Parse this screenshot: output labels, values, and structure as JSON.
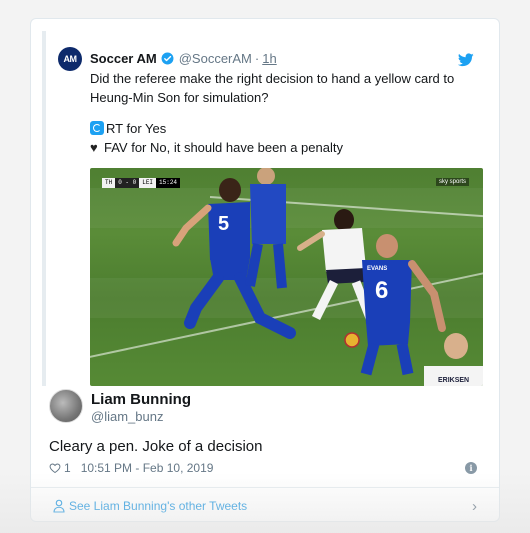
{
  "quoted_tweet": {
    "author_name": "Soccer AM",
    "author_handle": "@SoccerAM",
    "separator": "·",
    "time": "1h",
    "avatar_text": "AM",
    "text_line1": "Did the referee make the right decision to hand a yellow card to",
    "text_line2": "Heung-Min Son for simulation?",
    "rt_option": "RT for Yes",
    "fav_option": "FAV for No, it should have been a penalty",
    "image_overlay": {
      "team_a": "TH",
      "score": "0 - 0",
      "team_b": "LEI",
      "clock": "15:24",
      "channel_badge": "sky sports",
      "jersey_1": "5",
      "jersey_2": "6",
      "jersey_name": "EVANS",
      "jersey_name_2": "ERIKSEN"
    }
  },
  "tweet": {
    "author_name": "Liam Bunning",
    "author_handle": "@liam_bunz",
    "text": "Cleary a pen. Joke of a decision",
    "like_count": "1",
    "timestamp": "10:51 PM - Feb 10, 2019"
  },
  "footer": {
    "link_text": "See Liam Bunning's other Tweets"
  },
  "colors": {
    "twitter_blue": "#1da1f2",
    "link_blue": "#1b95e0",
    "muted": "#657786",
    "leicester_blue": "#1a3fb8"
  }
}
